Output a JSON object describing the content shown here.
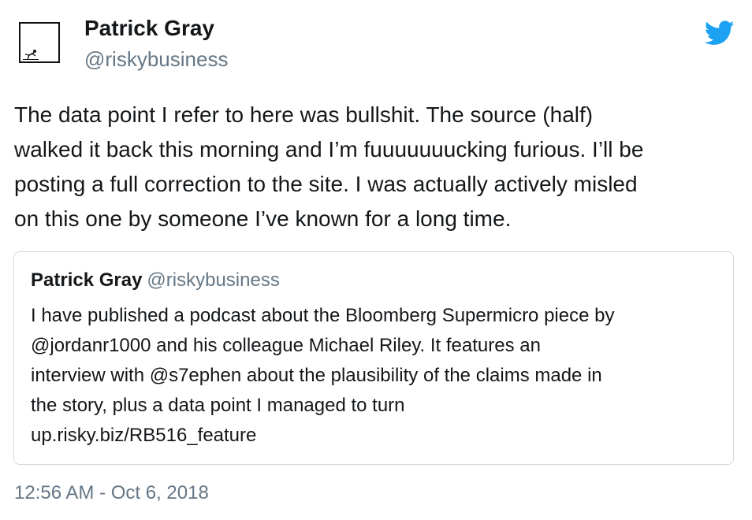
{
  "author": {
    "name": "Patrick Gray",
    "handle": "@riskybusiness",
    "avatar_icon": "stick-figure-icon"
  },
  "brand": {
    "icon": "twitter-bird-icon",
    "color": "#1da1f2"
  },
  "tweet": {
    "text": "The data point I refer to here was bullshit. The source (half)\nwalked it back this morning and I’m fuuuuuuucking furious. I’ll be\nposting a full correction to the site. I was actually actively misled\non this one by someone I’ve known for a long time.",
    "timestamp": "12:56 AM - Oct 6, 2018"
  },
  "quoted_tweet": {
    "name": "Patrick Gray",
    "handle": "@riskybusiness",
    "text": "I have published a podcast about the Bloomberg Supermicro piece by\n@jordanr1000 and his colleague Michael Riley. It features an\ninterview with @s7ephen about the plausibility of the claims made in\nthe story, plus a data point I managed to turn\nup.risky.biz/RB516_feature"
  },
  "colors": {
    "text": "#14171a",
    "secondary": "#657786",
    "border": "#cfd9de"
  }
}
